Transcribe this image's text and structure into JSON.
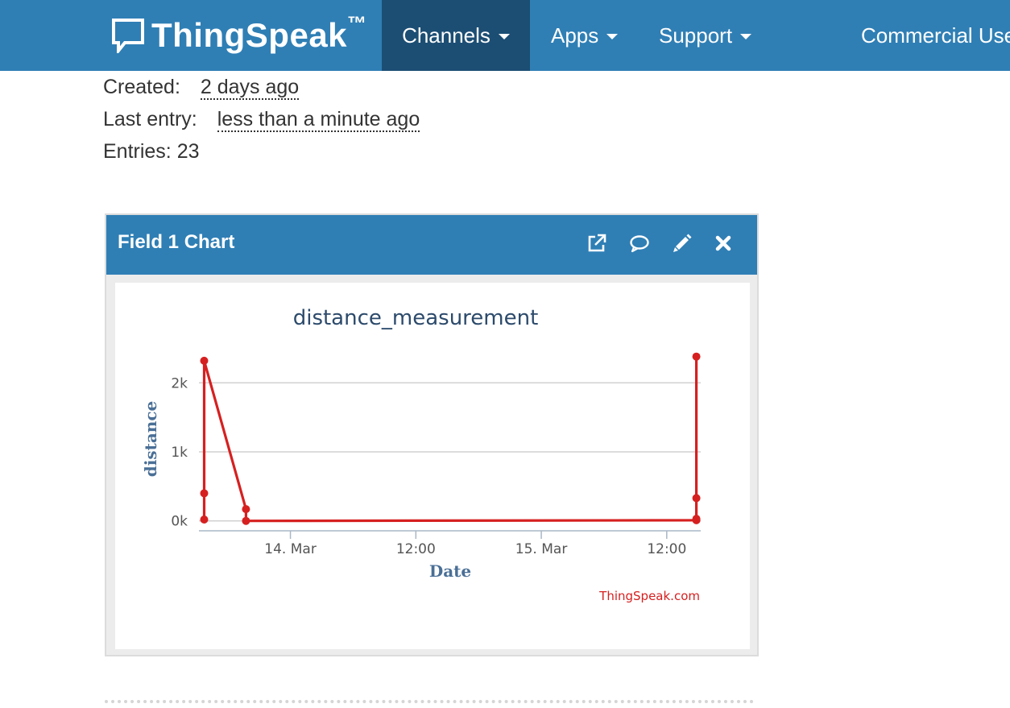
{
  "nav": {
    "brand": "ThingSpeak",
    "brand_tm": "™",
    "items": [
      {
        "label": "Channels"
      },
      {
        "label": "Apps"
      },
      {
        "label": "Support"
      },
      {
        "label": "Commercial Use"
      }
    ]
  },
  "channel": {
    "created_label": "Created:",
    "created_value": "2 days ago",
    "last_entry_label": "Last entry:",
    "last_entry_value": "less than a minute ago",
    "entries_text": "Entries: 23"
  },
  "widget": {
    "title": "Field 1 Chart",
    "icons": [
      "external-link-icon",
      "comment-icon",
      "pencil-icon",
      "close-icon"
    ]
  },
  "colors": {
    "navbar": "#2f7fb5",
    "navbar_active": "#1c4e74",
    "series": "#d62020",
    "axis_label": "#4a6f96"
  },
  "chart_data": {
    "type": "line",
    "title": "distance_measurement",
    "xlabel": "Date",
    "ylabel": "distance",
    "x_ticks": [
      {
        "label": "14. Mar",
        "x": "2023-03-14T00:00"
      },
      {
        "label": "12:00",
        "x": "2023-03-14T12:00"
      },
      {
        "label": "15. Mar",
        "x": "2023-03-15T00:00"
      },
      {
        "label": "12:00",
        "x": "2023-03-15T12:00"
      }
    ],
    "y_ticks": [
      {
        "label": "0k",
        "value": 0
      },
      {
        "label": "1k",
        "value": 1000
      },
      {
        "label": "2k",
        "value": 2000
      }
    ],
    "xlim": [
      "2023-03-13T15:15",
      "2023-03-15T15:15"
    ],
    "ylim": [
      -120,
      2400
    ],
    "grid": "horizontal",
    "credit": "ThingSpeak.com",
    "series": [
      {
        "color": "#d62020",
        "points": [
          {
            "x": "2023-03-13T15:45",
            "y": 20
          },
          {
            "x": "2023-03-13T15:45",
            "y": 400
          },
          {
            "x": "2023-03-13T15:45",
            "y": 2320
          },
          {
            "x": "2023-03-13T19:45",
            "y": 170
          },
          {
            "x": "2023-03-13T19:45",
            "y": 0
          },
          {
            "x": "2023-03-15T14:50",
            "y": 10
          },
          {
            "x": "2023-03-15T14:50",
            "y": 30
          },
          {
            "x": "2023-03-15T14:50",
            "y": 330
          },
          {
            "x": "2023-03-15T14:50",
            "y": 2380
          }
        ]
      }
    ]
  }
}
